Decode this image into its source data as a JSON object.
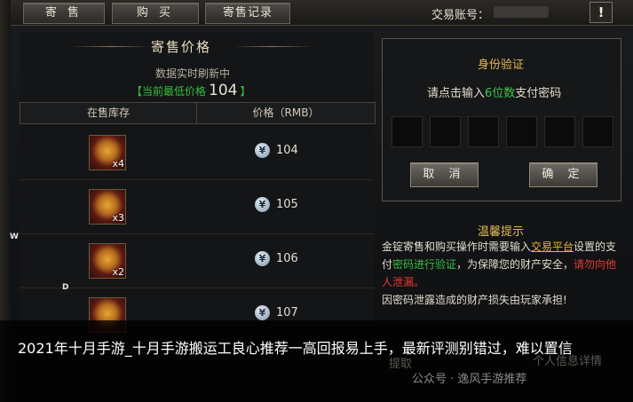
{
  "tabs": [
    "寄 售",
    "购 买",
    "寄售记录"
  ],
  "account": {
    "label": "交易账号：",
    "warning_icon": "!"
  },
  "consignment": {
    "title": "寄售价格",
    "refresh_text": "数据实时刷新中",
    "lowest_open": "【当前最低价格",
    "lowest_value": "104",
    "lowest_close": "】",
    "columns": [
      "在售库存",
      "价格（RMB）"
    ],
    "rows": [
      {
        "qty": "x4",
        "price": "104"
      },
      {
        "qty": "x3",
        "price": "105"
      },
      {
        "qty": "x2",
        "price": "106"
      },
      {
        "qty": "",
        "price": "107"
      }
    ]
  },
  "identity": {
    "title": "身份验证",
    "hint_pre": "请点击输入",
    "hint_hl": "6位数",
    "hint_post": "支付密码",
    "cancel": "取 消",
    "confirm": "确 定"
  },
  "tips": {
    "title": "温馨提示",
    "p1": "金锭寄售和购买操作时需要输入",
    "p2": "交易平台",
    "p3": "设置的支付",
    "p4": "密码进行验证",
    "p5": "，为保障您的财产安全，",
    "p6": "请勿向他人泄漏。",
    "p7": "因密码泄露造成的财产损失由玩家承担!"
  },
  "overlay": {
    "text": "2021年十月手游_十月手游搬运工良心推荐一高回报易上手，最新评测别错过，难以置信",
    "watermark": "公众号 · 逸风手游推荐",
    "hidden_btn": "提取",
    "hidden_detail": "个人信息详情"
  },
  "stray": {
    "w": "W",
    "d": "D"
  },
  "colors": {
    "accent_green": "#36c144",
    "accent_gold": "#e3ba52",
    "warn_red": "#e43b31"
  }
}
